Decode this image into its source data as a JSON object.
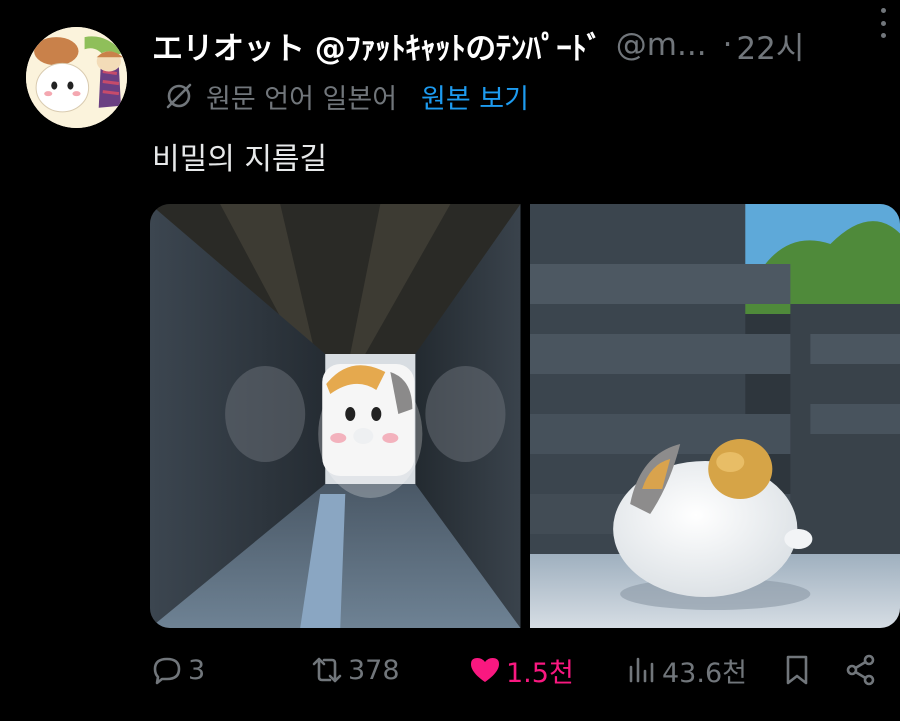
{
  "author": {
    "display_name": "エリオット @ﾌｧｯﾄｷｬｯﾄのﾃﾝﾊﾟｰﾄﾞ",
    "handle": "@m...",
    "separator": "·",
    "time": "22시",
    "avatar_icon": "cat-character-avatar"
  },
  "translation": {
    "icon": "translate-off-icon",
    "label": "원문 언어 일본어",
    "link": "원본 보기"
  },
  "post": {
    "text": "비밀의 지름길"
  },
  "media": [
    {
      "description": "fat-cat-in-narrow-gap-image"
    },
    {
      "description": "fat-cat-walking-image"
    }
  ],
  "actions": {
    "replies": "3",
    "retweets": "378",
    "likes": "1.5천",
    "views": "43.6천"
  },
  "colors": {
    "background": "#000000",
    "text": "#e7e9ea",
    "muted": "#71767b",
    "accent": "#1d9bf0",
    "like": "#f91880"
  }
}
